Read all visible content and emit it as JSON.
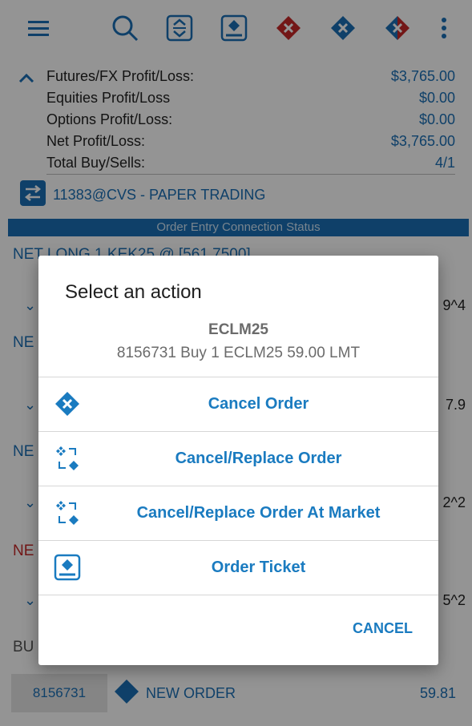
{
  "toolbar": {
    "icons": [
      "menu-icon",
      "search-icon",
      "expand-collapse-icon",
      "order-ticket-icon",
      "cancel-all-red-icon",
      "cancel-all-blue-icon",
      "cancel-all-mixed-icon",
      "overflow-menu-icon"
    ]
  },
  "pnl": {
    "rows": [
      {
        "label": "Futures/FX Profit/Loss:",
        "value": "$3,765.00"
      },
      {
        "label": "Equities Profit/Loss",
        "value": "$0.00"
      },
      {
        "label": "Options Profit/Loss:",
        "value": "$0.00"
      },
      {
        "label": "Net Profit/Loss:",
        "value": "$3,765.00"
      },
      {
        "label": "Total Buy/Sells:",
        "value": "4/1"
      }
    ]
  },
  "account": {
    "label": "11383@CVS - PAPER TRADING"
  },
  "status_bar": {
    "label": "Order Entry Connection Status"
  },
  "background_rows": {
    "net_long": "NET LONG 1 KEK25 @ [561.7500]",
    "r1_right": "9^4",
    "r2_left": "NE",
    "r2_right": "7.9",
    "r3_left": "NE",
    "r3_right": "2^2",
    "r4_left": "NE",
    "r4_right": "5^2",
    "r5_left": "BU"
  },
  "bottom_order": {
    "id": "8156731",
    "label": "NEW ORDER",
    "price": "59.81"
  },
  "dialog": {
    "title": "Select an action",
    "symbol": "ECLM25",
    "description": "8156731 Buy 1  ECLM25 59.00 LMT",
    "actions": [
      {
        "label": "Cancel Order",
        "icon": "cancel-diamond-icon"
      },
      {
        "label": "Cancel/Replace Order",
        "icon": "cancel-replace-icon"
      },
      {
        "label": "Cancel/Replace Order At Market",
        "icon": "cancel-replace-market-icon"
      },
      {
        "label": "Order Ticket",
        "icon": "order-ticket-icon"
      }
    ],
    "cancel_label": "CANCEL"
  },
  "colors": {
    "accent": "#1a7bc0",
    "scrim": "rgba(0,0,0,0.42)",
    "red": "#c62828"
  }
}
